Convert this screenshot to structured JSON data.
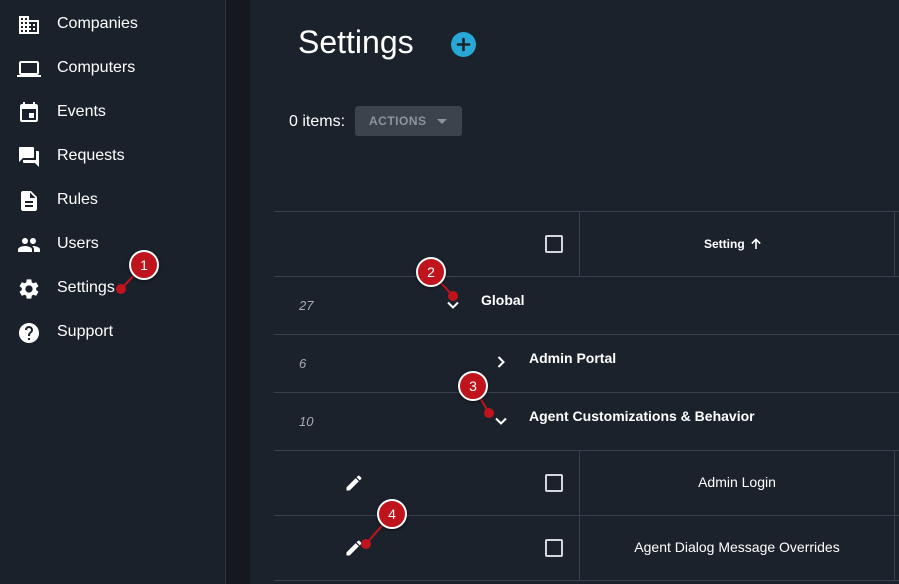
{
  "sidebar": {
    "items": [
      {
        "label": "Companies",
        "icon": "building-icon"
      },
      {
        "label": "Computers",
        "icon": "laptop-icon"
      },
      {
        "label": "Events",
        "icon": "calendar-icon"
      },
      {
        "label": "Requests",
        "icon": "chat-icon"
      },
      {
        "label": "Rules",
        "icon": "document-icon"
      },
      {
        "label": "Users",
        "icon": "users-icon"
      },
      {
        "label": "Settings",
        "icon": "gear-icon"
      },
      {
        "label": "Support",
        "icon": "help-icon"
      }
    ]
  },
  "page": {
    "title": "Settings",
    "items_label": "0 items:",
    "actions_label": "ACTIONS"
  },
  "table": {
    "header": {
      "setting": "Setting",
      "sort": "ascending"
    },
    "groups": [
      {
        "count": "27",
        "label": "Global",
        "expanded": true
      },
      {
        "count": "6",
        "label": "Admin Portal",
        "expanded": false
      },
      {
        "count": "10",
        "label": "Agent Customizations & Behavior",
        "expanded": true
      }
    ],
    "rows": [
      {
        "setting": "Admin Login"
      },
      {
        "setting": "Agent Dialog Message Overrides"
      }
    ]
  },
  "annotations": [
    "1",
    "2",
    "3",
    "4"
  ],
  "colors": {
    "background": "#1c222c",
    "sidebar": "#1b212b",
    "accent": "#28a8d6",
    "marker": "#c0141c",
    "button": "#3c434d"
  }
}
